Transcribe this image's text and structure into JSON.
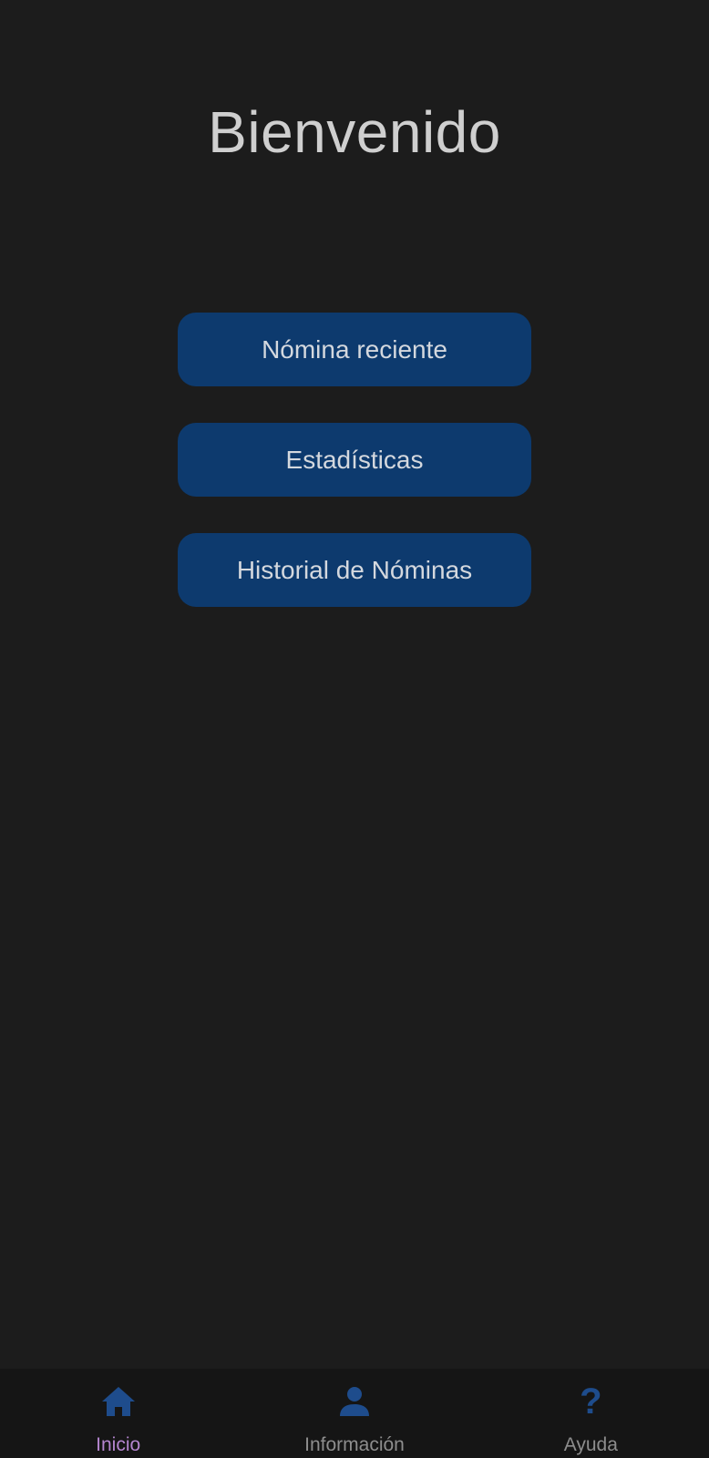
{
  "header": {
    "title": "Bienvenido"
  },
  "menu": {
    "items": [
      {
        "label": "Nómina reciente"
      },
      {
        "label": "Estadísticas"
      },
      {
        "label": "Historial de Nóminas"
      }
    ]
  },
  "bottom_nav": {
    "items": [
      {
        "label": "Inicio",
        "icon": "home-icon",
        "active": true
      },
      {
        "label": "Información",
        "icon": "person-icon",
        "active": false
      },
      {
        "label": "Ayuda",
        "icon": "help-icon",
        "active": false,
        "glyph": "?"
      }
    ]
  },
  "colors": {
    "background": "#1c1c1c",
    "button": "#0d3a6e",
    "nav_icon": "#1e4c8c",
    "nav_active_label": "#b485cf",
    "nav_label": "#8d8d8d"
  }
}
